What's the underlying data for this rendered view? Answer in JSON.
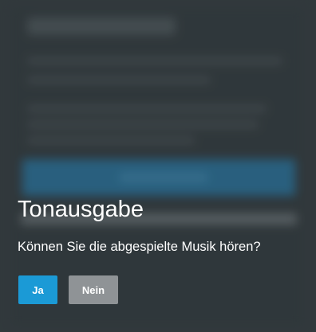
{
  "dialog": {
    "title": "Tonausgabe",
    "question": "Können Sie die abgespielte Musik hören?",
    "yes_label": "Ja",
    "no_label": "Nein"
  },
  "colors": {
    "yes_button": "#1b9ad6",
    "no_button": "#8f9396",
    "background": "#3d4448",
    "text": "#ffffff"
  }
}
